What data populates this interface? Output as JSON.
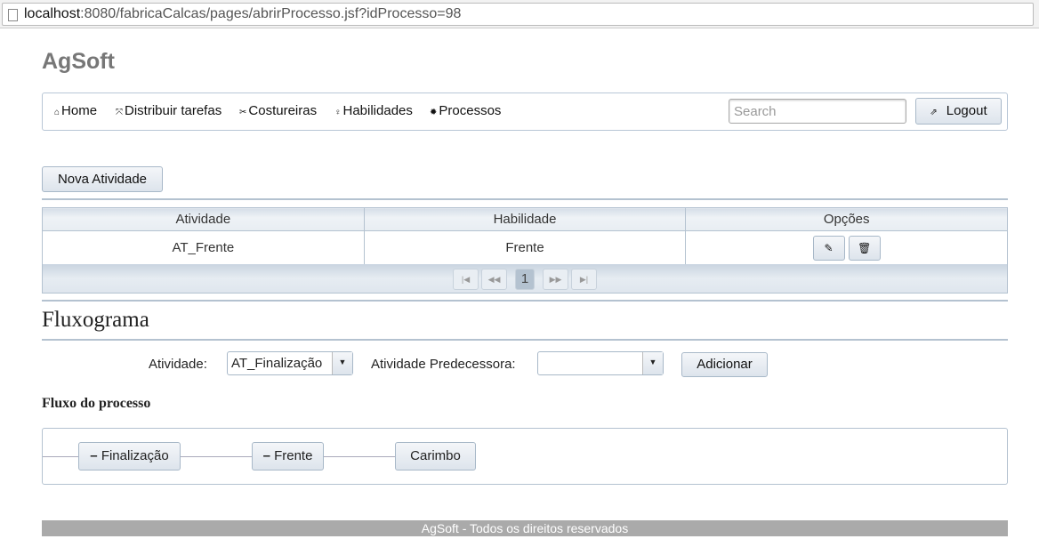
{
  "browser": {
    "url_host": "localhost",
    "url_rest": ":8080/fabricaCalcas/pages/abrirProcesso.jsf?idProcesso=98"
  },
  "brand": "AgSoft",
  "menu": {
    "items": [
      {
        "label": "Home",
        "icon": "home-icon"
      },
      {
        "label": "Distribuir tarefas",
        "icon": "arrows-icon"
      },
      {
        "label": "Costureiras",
        "icon": "scissors-icon"
      },
      {
        "label": "Habilidades",
        "icon": "lightbulb-icon"
      },
      {
        "label": "Processos",
        "icon": "gear-icon"
      }
    ],
    "search_placeholder": "Search",
    "logout": "Logout"
  },
  "nova_atividade": "Nova Atividade",
  "table": {
    "columns": [
      "Atividade",
      "Habilidade",
      "Opções"
    ],
    "rows": [
      {
        "atividade": "AT_Frente",
        "habilidade": "Frente"
      }
    ],
    "page": "1"
  },
  "fluxograma": {
    "title": "Fluxograma",
    "atividade_label": "Atividade:",
    "atividade_value": "AT_Finalização",
    "predecessora_label": "Atividade Predecessora:",
    "predecessora_value": "",
    "adicionar": "Adicionar"
  },
  "fluxo": {
    "title": "Fluxo do processo",
    "nodes": [
      "Finalização",
      "Frente",
      "Carimbo"
    ]
  },
  "footer": "AgSoft - Todos os direitos reservados"
}
